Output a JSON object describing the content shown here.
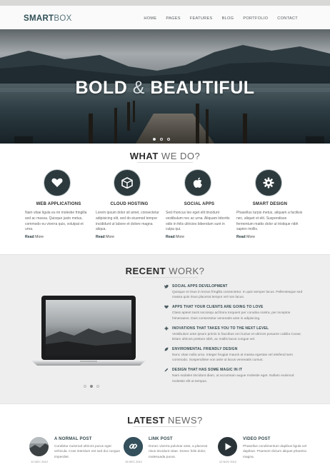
{
  "header": {
    "logo_bold": "SMART",
    "logo_light": "BOX",
    "nav": [
      "HOME",
      "PAGES",
      "FEATURES",
      "BLOG",
      "PORTFOLIO",
      "CONTACT"
    ]
  },
  "hero": {
    "title_left": "BOLD",
    "title_amp": "&",
    "title_right": "BEAUTIFUL"
  },
  "services": {
    "title_bold": "WHAT",
    "title_light": "WE DO?",
    "items": [
      {
        "title": "WEB APPLICATIONS",
        "text": "Nam vitae ligula eu mi molestie fringilla sed ac massa. Quisque justo metus, commodo eu viverra quis, volutpat et urna.",
        "more_bold": "Read",
        "more": "More",
        "icon": "heart-icon"
      },
      {
        "title": "CLOUD HOSTING",
        "text": "Lorem ipsum dolor sit amet, consectetur adipisicing elit, sed do eiusmod tempor incididunt ut labore et dolore magna aliqua.",
        "more_bold": "Read",
        "more": "More",
        "icon": "box-icon"
      },
      {
        "title": "SOCIAL APPS",
        "text": "Sed rhoncus leo eget elit tincidunt vestibulum nec ac urna. Aliquam lobortis odio in felis ultricies bibendum sunt in culpa qui.",
        "more_bold": "Read",
        "more": "More",
        "icon": "apple-icon"
      },
      {
        "title": "SMART DESIGN",
        "text": "Phasellus turpis metus, aliquam a facilisis nec, aliquet et elit. Suspendisse fermentum mattis dolor ut tristique nibh sapien mollis.",
        "more_bold": "Read",
        "more": "More",
        "icon": "gear-icon"
      }
    ]
  },
  "recent": {
    "title_bold": "RECENT",
    "title_light": "WORK?",
    "items": [
      {
        "icon": "twitter-icon",
        "head": "SOCIAL APPS DEVELOPMENT",
        "body": "Quisque et risus in lectus fringilla consectetur. In quis semper lacus. Pellentesque sed massa quis risus placerat tempor vel non lacus."
      },
      {
        "icon": "heart-icon",
        "head": "APPS THAT YOUR CLIENTS ARE GOING TO LOVE",
        "body": "Class aptent taciti sociosqu ad litora torquent per conubia nostra, per inceptos himenaeos. Duis consectetur venenatis ante in adipiscing."
      },
      {
        "icon": "gear-icon",
        "head": "INOVATIONS THAT TAKES YOU TO THE NEXT LEVEL",
        "body": "Vestibulum ante ipsum primis in faucibus orci luctus et ultrices posuere cubilia Curae; Etiam ultrices pretium nibh, ac mollis lacus congue vel."
      },
      {
        "icon": "leaf-icon",
        "head": "ENVIROMENTAL FRIENDLY DESIGN",
        "body": "Nunc vitae nulla urna. Integer feugiat mauris at massa egestas vel eleifend sem commodo. Suspendisse non ante ut lacus venenatis cursus."
      },
      {
        "icon": "pencil-icon",
        "head": "DESIGN THAT HAS SOME MAGIC IN IT",
        "body": "Nam sodales tincidunt diam, ut accumsan augue molestie eget. Nullam euismod molestie elit ut tempus."
      }
    ]
  },
  "news": {
    "title_bold": "LATEST",
    "title_light": "NEWS?",
    "items": [
      {
        "title": "A NORMAL POST",
        "date": "12 DEC 2012",
        "body": "Curabitur euismod ultrices purus eget vehicula. Cras interdum est sed dui congue imperdiet.",
        "thumb": "photo"
      },
      {
        "title": "LINK POST",
        "date": "15 DEC 2012",
        "body": "Donec viverra pulvinar ante, a placerat risus tincidunt vitae. Donec felis dolor, malesuada purus.",
        "thumb": "link-icon"
      },
      {
        "title": "VIDEO POST",
        "date": "12 NOV 2012",
        "body": "Phasellus condimentum dapibus ligula vel dapibus. Praesent dictum aliquet pharetra magna.",
        "thumb": "play-icon"
      }
    ]
  },
  "colors": {
    "accent": "#2c3a3e",
    "heading": "#34484d",
    "band": "#eeeeee"
  }
}
